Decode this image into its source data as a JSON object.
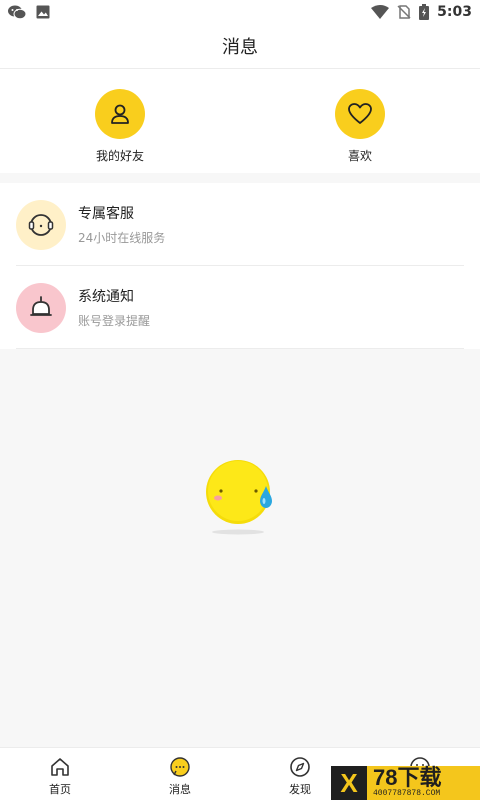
{
  "status_bar": {
    "time": "5:03"
  },
  "header": {
    "title": "消息"
  },
  "quick_actions": [
    {
      "label": "我的好友",
      "icon": "user-icon"
    },
    {
      "label": "喜欢",
      "icon": "heart-icon"
    }
  ],
  "messages": [
    {
      "title": "专属客服",
      "subtitle": "24小时在线服务",
      "icon": "customer-service-icon"
    },
    {
      "title": "系统通知",
      "subtitle": "账号登录提醒",
      "icon": "notification-bell-icon"
    }
  ],
  "tabs": [
    {
      "label": "首页",
      "icon": "home-icon"
    },
    {
      "label": "消息",
      "icon": "message-icon",
      "active": true
    },
    {
      "label": "发现",
      "icon": "compass-icon"
    },
    {
      "label": "",
      "icon": "profile-icon"
    }
  ],
  "watermark": {
    "big": "78下载",
    "small": "4007787878.COM"
  },
  "colors": {
    "accent": "#f9ce1d",
    "service_bg": "#fff0c8",
    "notice_bg": "#f9c6cd",
    "background": "#f7f7f7"
  }
}
